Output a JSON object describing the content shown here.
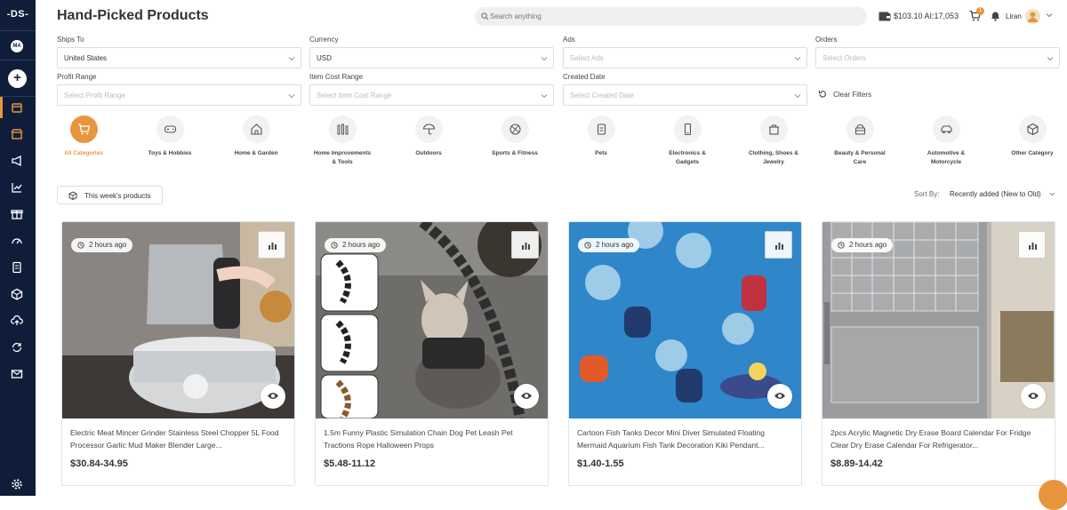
{
  "app": {
    "logo": "-DS-",
    "workspace_initials": "MA",
    "page_title": "Hand-Picked Products"
  },
  "header": {
    "search_placeholder": "Search anything",
    "balance": "$103.10 AI:17,053",
    "cart_count": "1",
    "user_name": "Liran"
  },
  "sidebar": {
    "items": [
      {
        "icon": "orders-icon"
      },
      {
        "icon": "store-icon"
      },
      {
        "icon": "megaphone-icon"
      },
      {
        "icon": "chart-icon"
      },
      {
        "icon": "gift-icon"
      },
      {
        "icon": "gauge-icon"
      },
      {
        "icon": "document-icon"
      },
      {
        "icon": "box-icon"
      },
      {
        "icon": "cloud-upload-icon"
      },
      {
        "icon": "sync-icon"
      },
      {
        "icon": "mail-icon"
      }
    ],
    "settings_icon": "gear-icon"
  },
  "filters": {
    "ships_to": {
      "label": "Ships To",
      "value": "United States"
    },
    "currency": {
      "label": "Currency",
      "value": "USD"
    },
    "ads": {
      "label": "Ads",
      "placeholder": "Select Ads"
    },
    "orders": {
      "label": "Orders",
      "placeholder": "Select Orders"
    },
    "profit_range": {
      "label": "Profit Range",
      "placeholder": "Select Profit Range"
    },
    "item_cost_range": {
      "label": "Item Cost Range",
      "placeholder": "Select Item Cost Range"
    },
    "created_date": {
      "label": "Created Date",
      "placeholder": "Select Created Date"
    },
    "clear_label": "Clear Filters"
  },
  "categories": [
    {
      "label": "All Categories",
      "icon": "cart-icon",
      "active": true
    },
    {
      "label": "Toys & Hobbies",
      "icon": "gamepad-icon"
    },
    {
      "label": "Home & Garden",
      "icon": "house-icon"
    },
    {
      "label": "Home Improvements & Tools",
      "icon": "tools-icon"
    },
    {
      "label": "Outdoors",
      "icon": "umbrella-icon"
    },
    {
      "label": "Sports & Fitness",
      "icon": "ball-icon"
    },
    {
      "label": "Pets",
      "icon": "pet-icon"
    },
    {
      "label": "Electronics & Gadgets",
      "icon": "phone-icon"
    },
    {
      "label": "Clothing, Shoes & Jewelry",
      "icon": "shirt-icon"
    },
    {
      "label": "Beauty & Personal Care",
      "icon": "beauty-icon"
    },
    {
      "label": "Automotive & Motorcycle",
      "icon": "car-icon"
    },
    {
      "label": "Other Category",
      "icon": "cube-icon"
    }
  ],
  "toolbar": {
    "week_button": "This week's products",
    "sort_label": "Sort By:",
    "sort_value": "Recently added (New to Old)"
  },
  "products": [
    {
      "time": "2 hours ago",
      "title": "Electric Meat Mincer Grinder Stainless Steel Chopper 5L Food Processor Garlic Mud Maker Blender Large...",
      "price": "$30.84-34.95"
    },
    {
      "time": "2 hours ago",
      "title": "1.5m Funny Plastic Simulation Chain Dog Pet Leash Pet Tractions Rope Halloween Props",
      "price": "$5.48-11.12"
    },
    {
      "time": "2 hours ago",
      "title": "Cartoon Fish Tanks Decor Mini Diver Simulated Floating Mermaid Aquarium Fish Tank Decoration Kiki Pendant...",
      "price": "$1.40-1.55"
    },
    {
      "time": "2 hours ago",
      "title": "2pcs Acrylic Magnetic Dry Erase Board Calendar For Fridge Clear Dry Erase Calendar For Refrigerator...",
      "price": "$8.89-14.42"
    }
  ],
  "colors": {
    "sidebar": "#101d3a",
    "accent": "#e8963d",
    "card_border": "#dbe5f1"
  }
}
